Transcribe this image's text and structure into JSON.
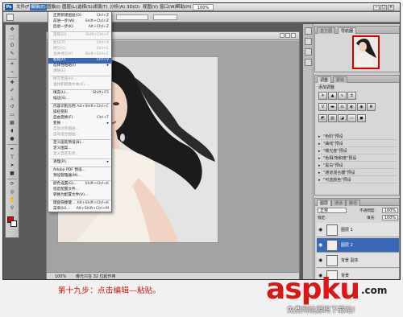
{
  "menubar": {
    "items": [
      "文件(F)",
      "编辑(E)",
      "图像(I)",
      "图层(L)",
      "选择(S)",
      "滤镜(T)",
      "分析(A)",
      "3D(D)",
      "视图(V)",
      "窗口(W)",
      "帮助(H)"
    ],
    "zoom": "100%"
  },
  "edit_menu": {
    "rows": [
      {
        "label": "还原新建图层(O)",
        "shortcut": "Ctrl+Z",
        "state": "normal"
      },
      {
        "label": "前进一步(W)",
        "shortcut": "Shift+Ctrl+Z",
        "state": "normal"
      },
      {
        "label": "后退一步(K)",
        "shortcut": "Alt+Ctrl+Z",
        "state": "normal"
      },
      {
        "label": "渐隐(D)...",
        "shortcut": "Shift+Ctrl+F",
        "state": "dim"
      },
      {
        "label": "剪切(T)",
        "shortcut": "Ctrl+X",
        "state": "dim"
      },
      {
        "label": "拷贝(C)",
        "shortcut": "Ctrl+C",
        "state": "dim"
      },
      {
        "label": "合并拷贝(Y)",
        "shortcut": "Shift+Ctrl+C",
        "state": "dim"
      },
      {
        "label": "粘贴(P)",
        "shortcut": "Ctrl+V",
        "state": "selected"
      },
      {
        "label": "选择性粘贴(I)",
        "shortcut": "",
        "state": "normal"
      },
      {
        "label": "清除(E)",
        "shortcut": "",
        "state": "dim"
      },
      {
        "label": "拼写检查(H)...",
        "shortcut": "",
        "state": "dim"
      },
      {
        "label": "查找和替换文本(X)...",
        "shortcut": "",
        "state": "dim"
      },
      {
        "label": "填充(L)...",
        "shortcut": "Shift+F5",
        "state": "normal"
      },
      {
        "label": "描边(S)...",
        "shortcut": "",
        "state": "normal"
      },
      {
        "label": "内容识别比例",
        "shortcut": "Alt+Shift+Ctrl+C",
        "state": "normal"
      },
      {
        "label": "操控变形",
        "shortcut": "",
        "state": "normal"
      },
      {
        "label": "自由变换(F)",
        "shortcut": "Ctrl+T",
        "state": "normal"
      },
      {
        "label": "变换",
        "shortcut": "",
        "state": "normal"
      },
      {
        "label": "自动对齐图层...",
        "shortcut": "",
        "state": "dim"
      },
      {
        "label": "自动混合图层...",
        "shortcut": "",
        "state": "dim"
      },
      {
        "label": "定义画笔预设(B)...",
        "shortcut": "",
        "state": "normal"
      },
      {
        "label": "定义图案...",
        "shortcut": "",
        "state": "normal"
      },
      {
        "label": "定义自定形状...",
        "shortcut": "",
        "state": "dim"
      },
      {
        "label": "清理(R)",
        "shortcut": "",
        "state": "normal"
      },
      {
        "label": "Adobe PDF 预设...",
        "shortcut": "",
        "state": "normal"
      },
      {
        "label": "预设管理器(M)...",
        "shortcut": "",
        "state": "normal"
      },
      {
        "label": "颜色设置(G)...",
        "shortcut": "Shift+Ctrl+K",
        "state": "normal"
      },
      {
        "label": "指定配置文件...",
        "shortcut": "",
        "state": "normal"
      },
      {
        "label": "转换为配置文件(V)...",
        "shortcut": "",
        "state": "normal"
      },
      {
        "label": "键盘快捷键...",
        "shortcut": "Alt+Shift+Ctrl+K",
        "state": "normal"
      },
      {
        "label": "菜单(U)...",
        "shortcut": "Alt+Shift+Ctrl+M",
        "state": "normal"
      },
      {
        "label": "首选项(N)",
        "shortcut": "",
        "state": "normal"
      }
    ]
  },
  "document": {
    "status_zoom": "100%",
    "status_info": "曝光只在 32 位起作用"
  },
  "panels": {
    "navigator_tabs": [
      "直方图",
      "导航器"
    ],
    "adjust_tabs": [
      "调整",
      "蒙版"
    ],
    "adjust_title": "添加调整",
    "presets": [
      "\"色阶\"预设",
      "\"曲线\"预设",
      "\"曝光度\"预设",
      "\"色相/饱和度\"预设",
      "\"黑白\"预设",
      "\"通道混合器\"预设",
      "\"可选颜色\"预设"
    ],
    "layers_tabs": [
      "图层",
      "通道",
      "路径"
    ],
    "blend_mode": "正常",
    "opacity_label": "不透明度:",
    "opacity_value": "100%",
    "lock_label": "锁定:",
    "fill_label": "填充:",
    "fill_value": "100%",
    "layers": [
      {
        "name": "图层 1",
        "active": false
      },
      {
        "name": "图层 2",
        "active": true
      },
      {
        "name": "背景 副本",
        "active": false
      },
      {
        "name": "背景",
        "active": false
      }
    ]
  },
  "caption": "第十九步：点击编辑—粘贴。",
  "watermark": {
    "brand": "aspku",
    "tld": ".com",
    "slogan": "免费网站源码下载站!"
  },
  "colors": {
    "foreground": "#d8081a",
    "highlight": "#3a66b5",
    "caption_red": "#cc1111"
  }
}
